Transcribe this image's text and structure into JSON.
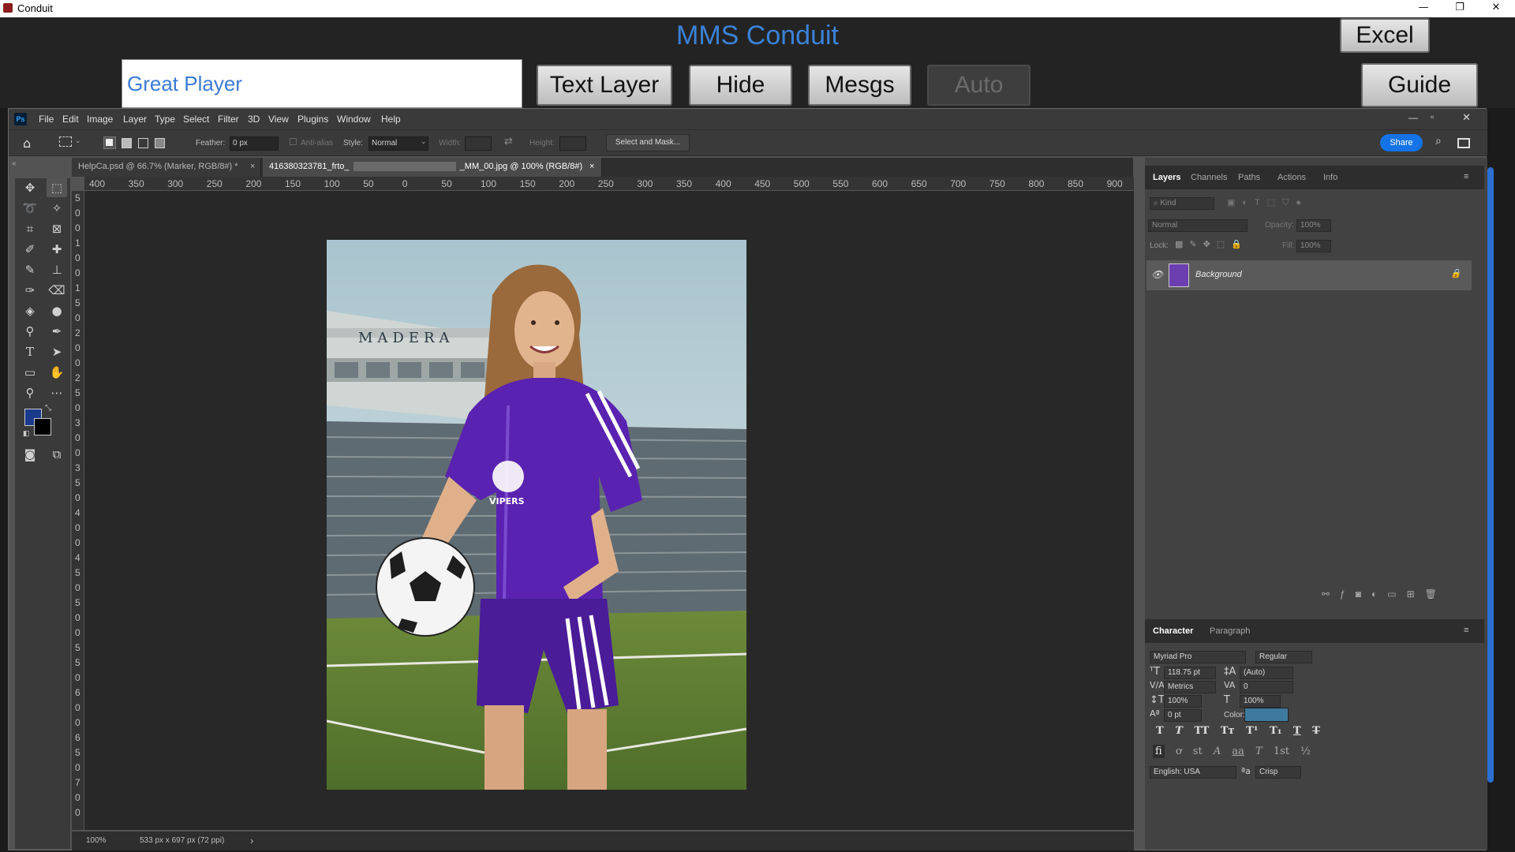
{
  "window": {
    "title": "Conduit",
    "minimize": "—",
    "restore": "❐",
    "close": "✕"
  },
  "conduit": {
    "title": "MMS Conduit",
    "player_input_value": "Great Player",
    "buttons": {
      "text_layer": "Text Layer",
      "hide": "Hide",
      "mesgs": "Mesgs",
      "auto": "Auto",
      "excel": "Excel",
      "guide": "Guide"
    }
  },
  "ps": {
    "logo": "Ps",
    "menu": [
      "File",
      "Edit",
      "Image",
      "Layer",
      "Type",
      "Select",
      "Filter",
      "3D",
      "View",
      "Plugins",
      "Window",
      "Help"
    ],
    "options": {
      "feather_label": "Feather:",
      "feather_value": "0 px",
      "antialias_label": "Anti-alias",
      "style_label": "Style:",
      "style_value": "Normal",
      "width_label": "Width:",
      "height_label": "Height:",
      "select_mask": "Select and Mask...",
      "share": "Share"
    },
    "tabs": [
      {
        "label": "HelpCa.psd @ 66.7% (Marker, RGB/8#) *"
      },
      {
        "label": "416380323781_frto_",
        "label2": "_MM_00.jpg @ 100% (RGB/8#)"
      }
    ],
    "ruler_top": [
      "400",
      "350",
      "300",
      "250",
      "200",
      "150",
      "100",
      "50",
      "0",
      "50",
      "100",
      "150",
      "200",
      "250",
      "300",
      "350",
      "400",
      "450",
      "500",
      "550",
      "600",
      "650",
      "700",
      "750",
      "800",
      "850",
      "900"
    ],
    "ruler_left": [
      "5",
      "0",
      "0",
      "1",
      "0",
      "0",
      "1",
      "5",
      "0",
      "2",
      "0",
      "0",
      "2",
      "5",
      "0",
      "3",
      "0",
      "0",
      "3",
      "5",
      "0",
      "4",
      "0",
      "0",
      "4",
      "5",
      "0",
      "5",
      "0",
      "0",
      "5",
      "5",
      "0",
      "6",
      "0",
      "0",
      "6",
      "5",
      "0",
      "7",
      "0",
      "0"
    ],
    "photo": {
      "banner_text": "MADERA",
      "jersey_text": "VIPERS"
    },
    "status": {
      "zoom": "100%",
      "doc_info": "533 px x 697 px (72 ppi)",
      "arrow": "›"
    },
    "colors": {
      "foreground": "#1b3a8c",
      "background": "#000000"
    }
  },
  "layers_panel": {
    "tabs": [
      "Layers",
      "Channels",
      "Paths",
      "Actions",
      "Info"
    ],
    "kind_label": "Kind",
    "blend_mode": "Normal",
    "opacity_label": "Opacity:",
    "opacity_value": "100%",
    "lock_label": "Lock:",
    "fill_label": "Fill:",
    "fill_value": "100%",
    "layer_name": "Background"
  },
  "character_panel": {
    "tabs": [
      "Character",
      "Paragraph"
    ],
    "font_family": "Myriad Pro",
    "font_style": "Regular",
    "size": "118.75 pt",
    "leading": "(Auto)",
    "kerning": "Metrics",
    "tracking": "0",
    "vscale": "100%",
    "hscale": "100%",
    "baseline": "0 pt",
    "color_label": "Color:",
    "color_value": "#3e7aa0",
    "language": "English: USA",
    "antialias": "Crisp",
    "antialias_prefix": "ªa",
    "fmt1": [
      "T",
      "T",
      "TT",
      "Tт",
      "T¹",
      "T₁",
      "T",
      "T"
    ],
    "fmt2": [
      "fi",
      "ơ",
      "st",
      "A",
      "aa",
      "T",
      "1st",
      "½"
    ]
  }
}
